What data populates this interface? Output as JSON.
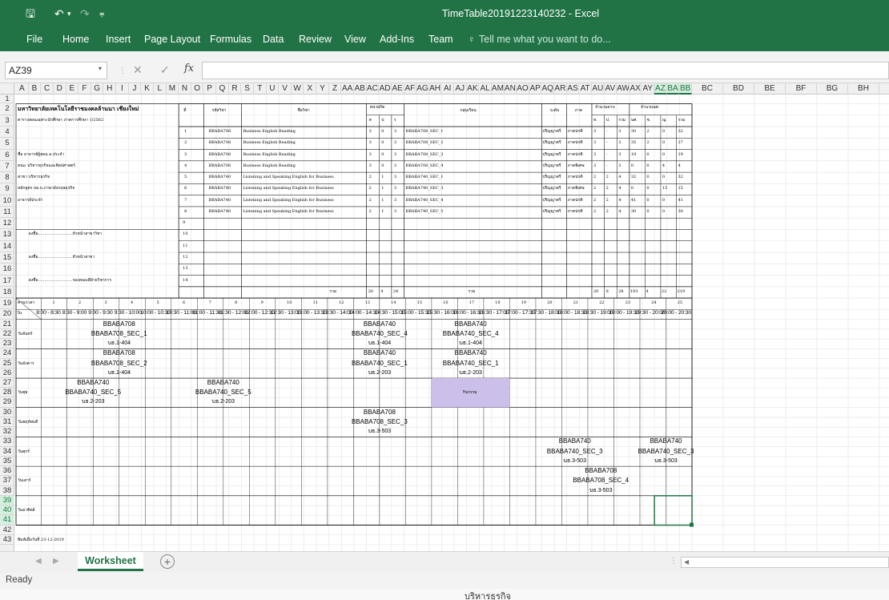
{
  "window": {
    "title": "TimeTable20191223140232 - Excel"
  },
  "qat": {
    "save": "🖫",
    "undo": "↶",
    "undo_dd": "▾",
    "redo": "↷",
    "custom": "⩦"
  },
  "ribbon": {
    "tabs": [
      "File",
      "Home",
      "Insert",
      "Page Layout",
      "Formulas",
      "Data",
      "Review",
      "View",
      "Add-Ins",
      "Team"
    ],
    "tell_icon": "♀",
    "tell_me": "Tell me what you want to do..."
  },
  "formula_bar": {
    "name_box": "AZ39",
    "name_arrow": "▾",
    "sep": "⋮",
    "cancel": "✕",
    "enter": "✓",
    "fx": "fx",
    "value": ""
  },
  "columns": [
    "A",
    "B",
    "C",
    "D",
    "E",
    "F",
    "G",
    "H",
    "I",
    "J",
    "K",
    "L",
    "M",
    "N",
    "O",
    "P",
    "Q",
    "R",
    "S",
    "T",
    "U",
    "V",
    "W",
    "X",
    "Y",
    "Z",
    "AA",
    "AB",
    "AC",
    "AD",
    "AE",
    "AF",
    "AG",
    "AH",
    "AI",
    "AJ",
    "AK",
    "AL",
    "AM",
    "AN",
    "AO",
    "AP",
    "AQ",
    "AR",
    "AS",
    "AT",
    "AU",
    "AV",
    "AW",
    "AX",
    "AY",
    "AZ",
    "BA",
    "BB",
    "BC",
    "BD",
    "BE",
    "BF",
    "BG",
    "BH",
    "BI"
  ],
  "selected_cols": [
    "AZ",
    "BA",
    "BB"
  ],
  "rows": [
    "1",
    "2",
    "3",
    "4",
    "5",
    "6",
    "7",
    "8",
    "9",
    "10",
    "11",
    "12",
    "13",
    "14",
    "15",
    "16",
    "17",
    "18",
    "19",
    "20",
    "21",
    "22",
    "23",
    "24",
    "25",
    "26",
    "27",
    "28",
    "29",
    "30",
    "31",
    "32",
    "33",
    "34",
    "35",
    "36",
    "37",
    "38",
    "39",
    "40",
    "41",
    "42",
    "43"
  ],
  "selected_rows": [
    "39",
    "40",
    "41"
  ],
  "sheet": {
    "university": "มหาวิทยาลัยเทคโนโลยีราชมงคลล้านนา เชียงใหม่",
    "term": "ตารางสอนเฉพาะนักศึกษา  ภาคการศึกษา 1/2562",
    "info": [
      "ชื่อ อาจารย์ผู้สอน อ.ประจำ",
      "คณะ บริหารธุรกิจและศิลปศาสตร์",
      "สาขา บริหารธุรกิจ",
      "หลักสูตร บธ.บ.ภาษาอังกฤษธุรกิจ",
      "อาจารย์ประจำ"
    ],
    "signatures": [
      "ลงชื่อ...........................หัวหน้าสาขาวิชา",
      "ลงชื่อ...........................หัวหน้าสาขา",
      "ลงชื่อ...........................รองคณบดีฝ่ายวิชาการ"
    ],
    "headers": {
      "no": "ที่",
      "code": "รหัสวิชา",
      "name": "ชื่อวิชา",
      "credit": "หน่วยกิต",
      "credit_sub": [
        "ท",
        "ป",
        "ร"
      ],
      "group": "กลุ่มเรียน",
      "level": "ระดับ",
      "type": "ภาค",
      "hours": "จำนวนคาบ",
      "hours_sub": [
        "ท.",
        "ป.",
        "รวม"
      ],
      "students": "จำนวนนศ.",
      "students_sub": [
        "นศ.",
        "ช.",
        "ญ.",
        "รวม"
      ]
    },
    "courses": [
      {
        "no": "1",
        "code": "BBABA708",
        "name": "Business English Reading",
        "t": "3",
        "p": "0",
        "c": "3",
        "group": "BBABA708_SEC_1",
        "level": "ปริญญาตรี",
        "type": "ภาคปกติ",
        "h1": "3",
        "h2": "-",
        "h3": "3",
        "s1": "30",
        "s2": "2",
        "s3": "0",
        "s4": "32"
      },
      {
        "no": "2",
        "code": "BBABA708",
        "name": "Business English Reading",
        "t": "3",
        "p": "0",
        "c": "3",
        "group": "BBABA708_SEC_2",
        "level": "ปริญญาตรี",
        "type": "ภาคปกติ",
        "h1": "3",
        "h2": "-",
        "h3": "3",
        "s1": "35",
        "s2": "2",
        "s3": "0",
        "s4": "37"
      },
      {
        "no": "3",
        "code": "BBABA708",
        "name": "Business English Reading",
        "t": "3",
        "p": "0",
        "c": "3",
        "group": "BBABA708_SEC_3",
        "level": "ปริญญาตรี",
        "type": "ภาคปกติ",
        "h1": "3",
        "h2": "-",
        "h3": "3",
        "s1": "19",
        "s2": "0",
        "s3": "0",
        "s4": "19"
      },
      {
        "no": "4",
        "code": "BBABA708",
        "name": "Business English Reading",
        "t": "3",
        "p": "0",
        "c": "3",
        "group": "BBABA708_SEC_4",
        "level": "ปริญญาตรี",
        "type": "ภาคพิเศษ",
        "h1": "3",
        "h2": "-",
        "h3": "3",
        "s1": "0",
        "s2": "0",
        "s3": "4",
        "s4": "4"
      },
      {
        "no": "5",
        "code": "BBABA740",
        "name": "Listening and Speaking English for Business",
        "t": "2",
        "p": "1",
        "c": "3",
        "group": "BBABA740_SEC_1",
        "level": "ปริญญาตรี",
        "type": "ภาคปกติ",
        "h1": "2",
        "h2": "2",
        "h3": "4",
        "s1": "32",
        "s2": "0",
        "s3": "0",
        "s4": "32"
      },
      {
        "no": "6",
        "code": "BBABA740",
        "name": "Listening and Speaking English for Business",
        "t": "2",
        "p": "1",
        "c": "3",
        "group": "BBABA740_SEC_3",
        "level": "ปริญญาตรี",
        "type": "ภาคพิเศษ",
        "h1": "2",
        "h2": "2",
        "h3": "4",
        "s1": "0",
        "s2": "0",
        "s3": "15",
        "s4": "15"
      },
      {
        "no": "7",
        "code": "BBABA740",
        "name": "Listening and Speaking English for Business",
        "t": "2",
        "p": "1",
        "c": "3",
        "group": "BBABA740_SEC_4",
        "level": "ปริญญาตรี",
        "type": "ภาคปกติ",
        "h1": "2",
        "h2": "2",
        "h3": "4",
        "s1": "41",
        "s2": "0",
        "s3": "0",
        "s4": "41"
      },
      {
        "no": "8",
        "code": "BBABA740",
        "name": "Listening and Speaking English for Business",
        "t": "2",
        "p": "1",
        "c": "3",
        "group": "BBABA740_SEC_5",
        "level": "ปริญญาตรี",
        "type": "ภาคปกติ",
        "h1": "2",
        "h2": "2",
        "h3": "4",
        "s1": "30",
        "s2": "0",
        "s3": "0",
        "s4": "30"
      }
    ],
    "empty_rows": [
      "9",
      "10",
      "11",
      "12",
      "13",
      "14"
    ],
    "totals": {
      "label": "รวม",
      "label2": "รวม",
      "t": "20",
      "p": "4",
      "c": "24",
      "h1": "20",
      "h2": "8",
      "h3": "28",
      "s1": "193",
      "s2": "4",
      "s3": "22",
      "s4": "219"
    },
    "period_label": "คาบ/เวลา",
    "day_label": "วัน",
    "periods": [
      "1",
      "2",
      "3",
      "4",
      "5",
      "6",
      "7",
      "8",
      "9",
      "10",
      "11",
      "12",
      "13",
      "14",
      "15",
      "16",
      "17",
      "18",
      "19",
      "20",
      "21",
      "22",
      "23",
      "24",
      "25"
    ],
    "slots": [
      "8:00 - 8:30",
      "8:30 - 9:00",
      "9:00 - 9:30",
      "9:30 - 10:00",
      "10:00 - 10:30",
      "10:30 - 11:00",
      "11:00 - 11:30",
      "11:30 - 12:00",
      "12:00 - 12:30",
      "12:30 - 13:00",
      "13:00 - 13:30",
      "13:30 - 14:00",
      "14:00 - 14:30",
      "14:30 - 15:00",
      "15:00 - 15:30",
      "15:30 - 16:00",
      "16:00 - 16:30",
      "16:30 - 17:00",
      "17:00 - 17:30",
      "17:30 - 18:00",
      "18:00 - 18:30",
      "18:30 - 19:00",
      "19:00 - 19:30",
      "19:30 - 20:00",
      "20:00 - 20:30"
    ],
    "days": [
      "วันจันทร์",
      "วันอังคาร",
      "วันพุธ",
      "วันพฤหัสบดี",
      "วันศุกร์",
      "วันเสาร์",
      "วันอาทิตย์"
    ],
    "classes": [
      {
        "code": "BBABA708",
        "sec": "BBABA708_SEC_1",
        "room": "บธ.1-404"
      },
      {
        "code": "BBABA740",
        "sec": "BBABA740_SEC_4",
        "room": "บธ.1-404"
      },
      {
        "code": "BBABA740",
        "sec": "BBABA740_SEC_4",
        "room": "บธ.1-404"
      },
      {
        "code": "BBABA708",
        "sec": "BBABA708_SEC_2",
        "room": "บธ.1-404"
      },
      {
        "code": "BBABA740",
        "sec": "BBABA740_SEC_1",
        "room": "บธ.2-203"
      },
      {
        "code": "BBABA740",
        "sec": "BBABA740_SEC_1",
        "room": "บธ.2-203"
      },
      {
        "code": "BBABA740",
        "sec": "BBABA740_SEC_5",
        "room": "บธ.2-203"
      },
      {
        "code": "BBABA740",
        "sec": "BBABA740_SEC_5",
        "room": "บธ.2-203"
      },
      {
        "code": "BBABA708",
        "sec": "BBABA708_SEC_3",
        "room": "บธ.3-503"
      },
      {
        "code": "BBABA740",
        "sec": "BBABA740_SEC_3",
        "room": "บธ.3-503"
      },
      {
        "code": "BBABA740",
        "sec": "BBABA740_SEC_3",
        "room": "บธ.3-503"
      },
      {
        "code": "BBABA708",
        "sec": "BBABA708_SEC_4",
        "room": "บธ.3-503"
      }
    ],
    "activity": "กิจกรรม",
    "print_date": "พิมพ์เมื่อวันที่ 23-12-2019"
  },
  "sheet_tabs": {
    "active": "Worksheet",
    "add": "+",
    "prev": "◀",
    "next": "▶",
    "scroll_sep": "⋮",
    "scroll_left": "◀"
  },
  "status": {
    "ready": "Ready"
  },
  "taskbar": {
    "label": "บริหารธุรกิจ"
  },
  "colors": {
    "excel_green": "#217346",
    "activity_fill": "#ccc0ea",
    "selection": "#217346"
  }
}
